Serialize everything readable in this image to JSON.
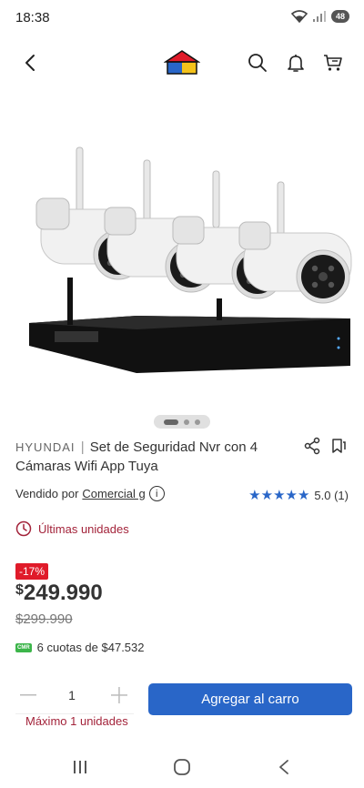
{
  "status_bar": {
    "time": "18:38",
    "battery": "48"
  },
  "nav": {
    "back_icon": "chevron-left-icon",
    "logo_icon": "house-logo-icon",
    "search_icon": "search-icon",
    "bell_icon": "bell-icon",
    "cart_icon": "cart-icon"
  },
  "product": {
    "brand": "HYUNDAI",
    "separator": "|",
    "title": "Set de Seguridad Nvr con 4 Cámaras Wifi App Tuya",
    "image_icon": "security-camera-set-image",
    "carousel_dots": 3,
    "carousel_active": 0,
    "seller_prefix": "Vendido por",
    "seller_name": "Comercial g",
    "info_symbol": "i",
    "rating": 5.0,
    "rating_text": "5.0 (1)",
    "stock_text": "Últimas unidades",
    "discount": "-17%",
    "currency": "$",
    "price": "249.990",
    "old_price": "$299.990",
    "cmr_label": "CMR",
    "installments": "6 cuotas de $47.532"
  },
  "purchase": {
    "quantity": "1",
    "max_units": "Máximo 1 unidades",
    "add_to_cart": "Agregar al carro"
  },
  "colors": {
    "accent_blue": "#2966c8",
    "stock_red": "#a3233a",
    "discount_red": "#e01b2a",
    "cmr_green": "#3cb54a"
  }
}
